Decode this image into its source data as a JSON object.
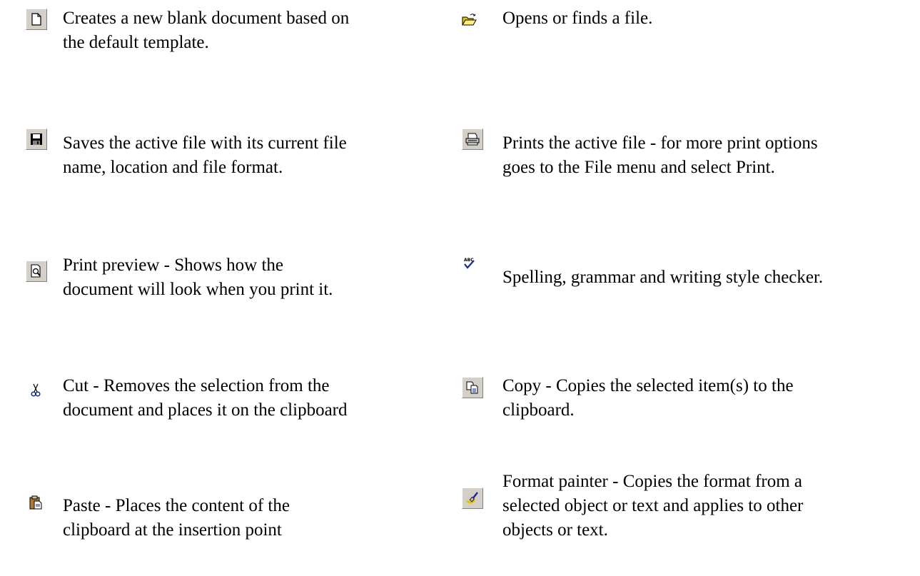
{
  "items": [
    {
      "icon": "new-document-icon",
      "line1": "Creates a new blank document based on",
      "line2": "the default template."
    },
    {
      "icon": "open-folder-icon",
      "line1": "Opens or finds a file.",
      "line2": ""
    },
    {
      "icon": "save-disk-icon",
      "line1": "Saves the active file with its current file",
      "line2": "name, location and file format."
    },
    {
      "icon": "printer-icon",
      "line1": "Prints the active file - for more print options",
      "line2": "goes to the File menu and select Print."
    },
    {
      "icon": "print-preview-icon",
      "line1": "Print preview - Shows how the",
      "line2": "document will look when you print it."
    },
    {
      "icon": "spelling-check-icon",
      "line1": "Spelling, grammar and writing style checker.",
      "line2": "",
      "abc": "ABC"
    },
    {
      "icon": "scissors-icon",
      "line1": "Cut - Removes the selection from the",
      "line2": "document and places it on the clipboard"
    },
    {
      "icon": "copy-icon",
      "line1": "Copy - Copies the selected item(s) to the",
      "line2": "clipboard."
    },
    {
      "icon": "paste-clipboard-icon",
      "line1": "Paste - Places the content of the",
      "line2": "clipboard at the insertion point"
    },
    {
      "icon": "format-painter-icon",
      "line1": "Format painter - Copies the format from a",
      "line2": "selected object or text and applies to other",
      "line3": "objects or text."
    }
  ]
}
